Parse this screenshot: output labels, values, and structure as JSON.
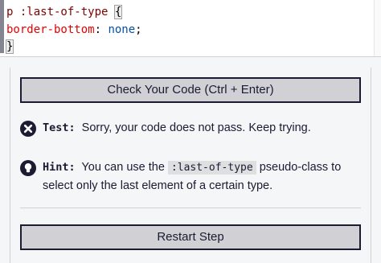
{
  "editor": {
    "line1": {
      "selector": "p :last-of-type",
      "brace": "{"
    },
    "line2": {
      "property": "border-bottom",
      "colon": ":",
      "value": "none",
      "semicolon": ";"
    },
    "line3": {
      "brace": "}"
    }
  },
  "panel": {
    "check_button_label": "Check Your Code (Ctrl + Enter)",
    "test": {
      "icon": "x-circle-icon",
      "label": "Test:",
      "message": "Sorry, your code does not pass. Keep trying."
    },
    "hint": {
      "icon": "lightbulb-icon",
      "label": "Hint:",
      "text_before": "You can use the",
      "code": ":last-of-type",
      "text_after": "pseudo-class to select only the last element of a certain type."
    },
    "restart_button_label": "Restart Step"
  },
  "colors": {
    "button_bg": "#d0d0d5",
    "text": "#1b1b32",
    "selector": "#800000",
    "property": "#e50000",
    "value": "#0451a5"
  }
}
